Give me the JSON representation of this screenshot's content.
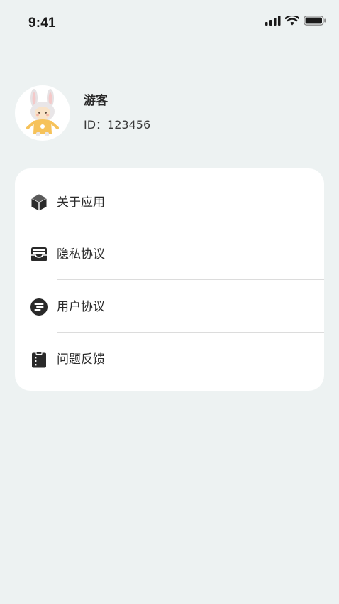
{
  "status_bar": {
    "time": "9:41",
    "icons": [
      "signal-icon",
      "wifi-icon",
      "battery-icon"
    ]
  },
  "profile": {
    "name": "游客",
    "id_text": "ID：123456",
    "avatar": "rabbit-avatar"
  },
  "menu": {
    "items": [
      {
        "label": "关于应用",
        "icon": "cube-icon"
      },
      {
        "label": "隐私协议",
        "icon": "inbox-icon"
      },
      {
        "label": "用户协议",
        "icon": "list-circle-icon"
      },
      {
        "label": "问题反馈",
        "icon": "clipboard-icon"
      }
    ]
  },
  "colors": {
    "background": "#edf2f2",
    "card": "#ffffff",
    "text": "#2b2b2b",
    "divider": "#dcdcdc"
  }
}
